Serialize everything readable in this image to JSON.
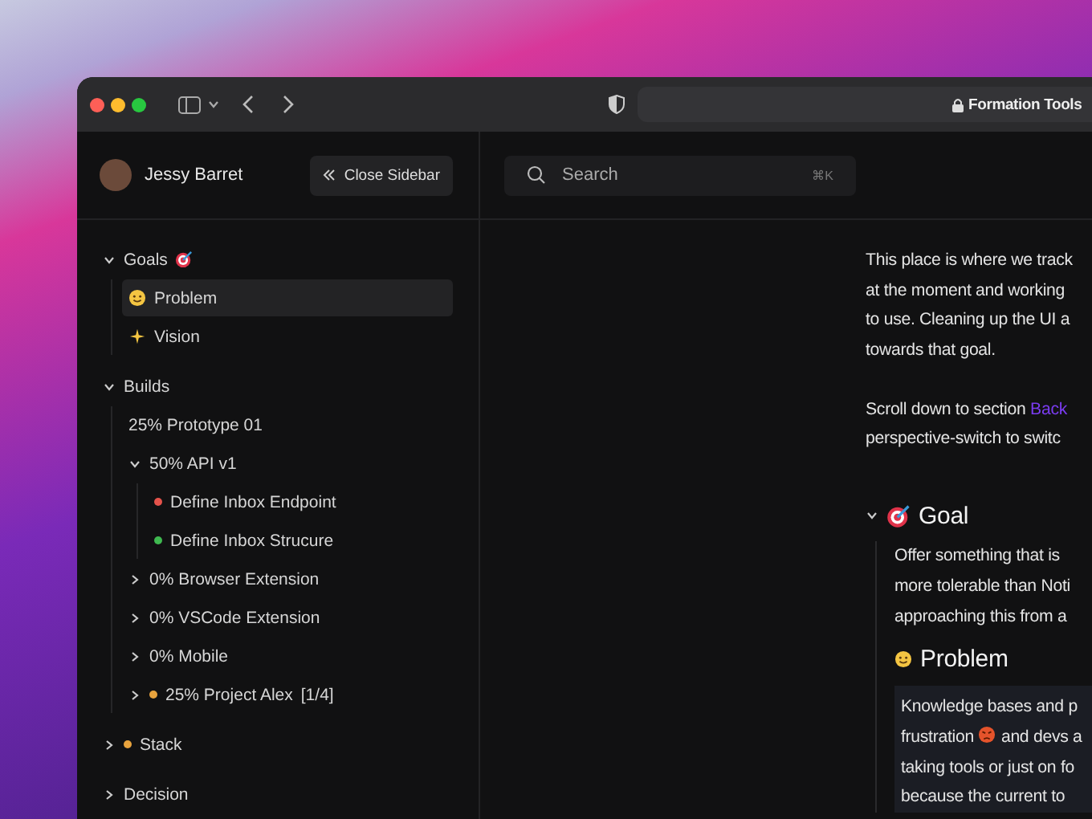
{
  "browser": {
    "url": "Formation Tools"
  },
  "sidebar": {
    "user": {
      "name": "Jessy Barret"
    },
    "close_button": "Close Sidebar",
    "tree": [
      {
        "label": "Goals",
        "kind": "target",
        "expanded": true,
        "selected": false,
        "children": [
          {
            "label": "Problem",
            "kind": "face",
            "selected": true
          },
          {
            "label": "Vision",
            "kind": "sparkle",
            "selected": false
          }
        ]
      },
      {
        "label": "Builds",
        "kind": "plain",
        "expanded": true,
        "selected": false,
        "children": [
          {
            "label": "25% Prototype 01",
            "kind": "plain",
            "selected": false
          },
          {
            "label": "50% API v1",
            "kind": "plain",
            "expanded": true,
            "selected": false,
            "children": [
              {
                "label": "Define Inbox Endpoint",
                "kind": "dot",
                "color": "#e5534b",
                "selected": false
              },
              {
                "label": "Define Inbox Strucure",
                "kind": "dot",
                "color": "#3fb950",
                "selected": false
              }
            ]
          },
          {
            "label": "0% Browser Extension",
            "kind": "plain",
            "expanded": false,
            "selected": false
          },
          {
            "label": "0% VSCode Extension",
            "kind": "plain",
            "expanded": false,
            "selected": false
          },
          {
            "label": "0% Mobile",
            "kind": "plain",
            "expanded": false,
            "selected": false
          },
          {
            "label": "25% Project Alex",
            "count": "[1/4]",
            "kind": "dot",
            "color": "#e8a33d",
            "expanded": false,
            "selected": false
          }
        ]
      },
      {
        "label": "Stack",
        "kind": "dot",
        "color": "#e8a33d",
        "expanded": false,
        "selected": false
      },
      {
        "label": "Decision",
        "kind": "plain",
        "expanded": false,
        "selected": false
      }
    ]
  },
  "search": {
    "placeholder": "Search",
    "shortcut": "⌘K"
  },
  "document": {
    "intro": [
      "This place is where we track",
      "at the moment and working",
      "to use. Cleaning up the UI a",
      "towards that goal."
    ],
    "scroll_note": {
      "text": "Scroll down to section ",
      "link": "Back",
      "line_2": "perspective-switch to switc"
    },
    "goal": {
      "heading": "Goal",
      "expanded": true,
      "lines": [
        "Offer something that is",
        "more tolerable than Noti",
        "approaching this from a"
      ]
    },
    "problem": {
      "heading": "Problem",
      "lines": [
        "Knowledge bases and p",
        "frustration",
        "and devs a",
        "taking tools or just on fo",
        "because the current to"
      ]
    }
  }
}
